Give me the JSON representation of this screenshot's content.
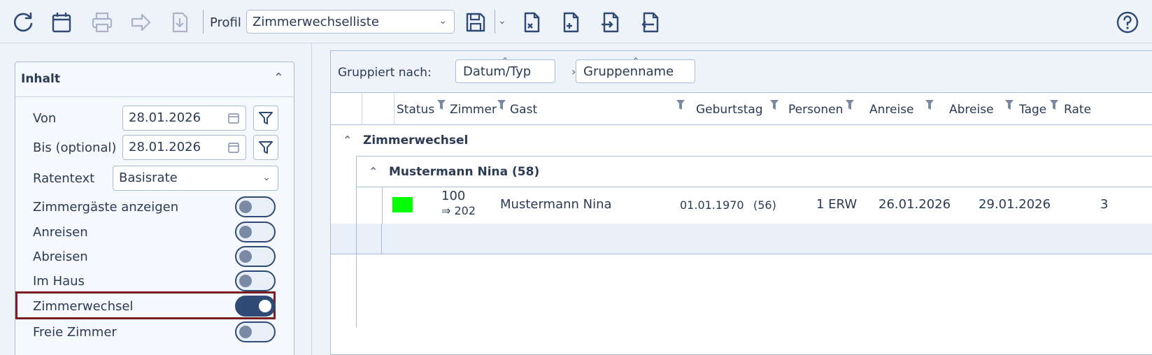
{
  "toolbar": {
    "profil_label": "Profil",
    "profil_value": "Zimmerwechselliste"
  },
  "left": {
    "section_title": "Inhalt",
    "von_label": "Von",
    "von_value": "28.01.2026",
    "bis_label": "Bis (optional)",
    "bis_value": "28.01.2026",
    "ratentext_label": "Ratentext",
    "ratentext_value": "Basisrate",
    "toggles": [
      {
        "label": "Zimmergäste anzeigen",
        "on": false
      },
      {
        "label": "Anreisen",
        "on": false
      },
      {
        "label": "Abreisen",
        "on": false
      },
      {
        "label": "Im Haus",
        "on": false
      },
      {
        "label": "Zimmerwechsel",
        "on": true
      },
      {
        "label": "Freie Zimmer",
        "on": false
      }
    ]
  },
  "grid": {
    "grouped_by_label": "Gruppiert nach:",
    "group_chips": [
      "Datum/Typ",
      "Gruppenname"
    ],
    "group_arrow": "›",
    "columns": [
      "Status",
      "Zimmer",
      "Gast",
      "Geburtstag",
      "Personen",
      "Anreise",
      "Abreise",
      "Tage",
      "Rate"
    ],
    "group1": "Zimmerwechsel",
    "group2": "Mustermann Nina (58)",
    "row": {
      "zimmer_from": "100",
      "zimmer_to": "⇒ 202",
      "gast": "Mustermann Nina",
      "geburtstag": "01.01.1970",
      "alter": "(56)",
      "personen": "1 ERW",
      "anreise": "26.01.2026",
      "abreise": "29.01.2026",
      "tage": "3",
      "status_color": "#00ff00"
    }
  }
}
